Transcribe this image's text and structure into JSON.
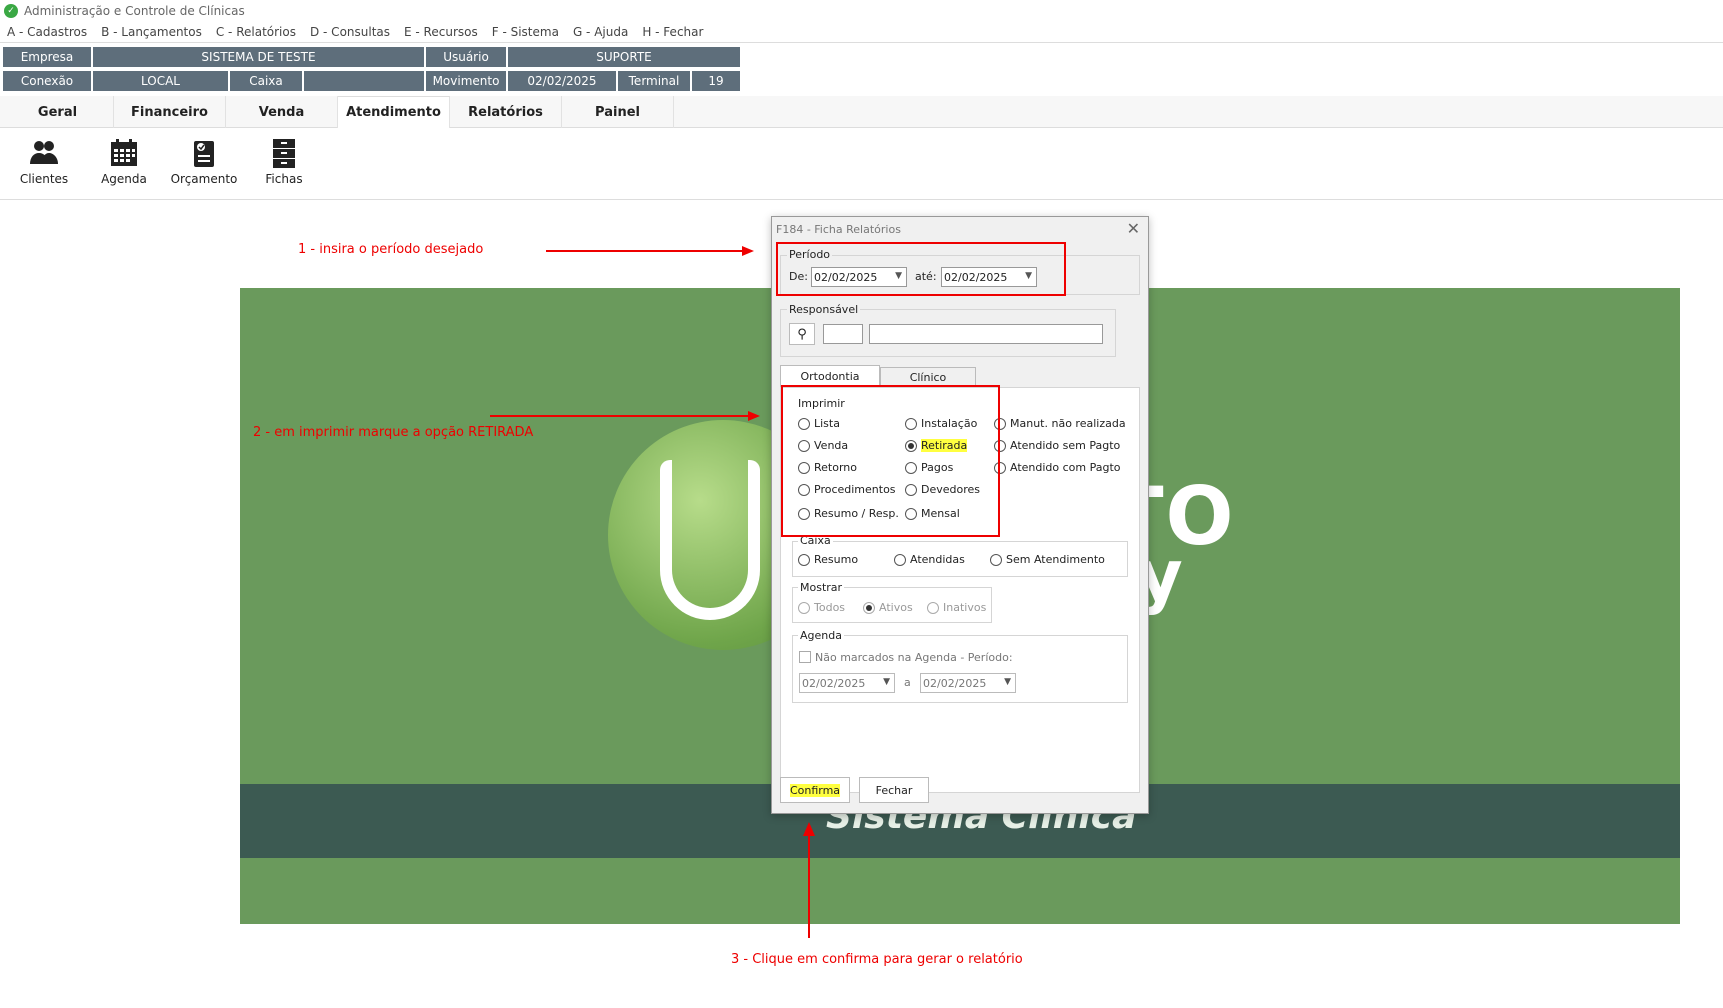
{
  "window": {
    "title": "Administração e Controle de Clínicas"
  },
  "menu": [
    "A - Cadastros",
    "B - Lançamentos",
    "C - Relatórios",
    "D - Consultas",
    "E - Recursos",
    "F - Sistema",
    "G - Ajuda",
    "H - Fechar"
  ],
  "info": {
    "empresa_label": "Empresa",
    "empresa_value": "SISTEMA DE TESTE",
    "usuario_label": "Usuário",
    "usuario_value": "SUPORTE",
    "conexao_label": "Conexão",
    "conexao_value": "LOCAL",
    "caixa_label": "Caixa",
    "caixa_value": "",
    "movimento_label": "Movimento",
    "movimento_value": "02/02/2025",
    "terminal_label": "Terminal",
    "terminal_value": "19"
  },
  "tabs": [
    "Geral",
    "Financeiro",
    "Venda",
    "Atendimento",
    "Relatórios",
    "Painel"
  ],
  "toolbar": [
    "Clientes",
    "Agenda",
    "Orçamento",
    "Fichas"
  ],
  "banner": {
    "word1": "NTO",
    "word2": "any",
    "subtitle": "Sistema Clínica"
  },
  "annotations": {
    "step1": "1 - insira o período desejado",
    "step2": "2 - em imprimir marque a opção RETIRADA",
    "step3": "3 - Clique em confirma para gerar o relatório"
  },
  "dialog": {
    "title": "F184 - Ficha Relatórios",
    "periodo_label": "Período",
    "de_label": "De:",
    "de_value": "02/02/2025",
    "ate_label": "até:",
    "ate_value": "02/02/2025",
    "responsavel_label": "Responsável",
    "tab_ortodontia": "Ortodontia",
    "tab_clinico": "Clínico",
    "imprimir_label": "Imprimir",
    "imprimir_options": [
      "Lista",
      "Venda",
      "Retorno",
      "Procedimentos",
      "Resumo / Resp.",
      "Instalação",
      "Retirada",
      "Pagos",
      "Devedores",
      "Mensal",
      "Manut. não realizada",
      "Atendido sem Pagto",
      "Atendido com Pagto"
    ],
    "imprimir_selected": "Retirada",
    "caixa_label": "Caixa",
    "caixa_options": [
      "Resumo",
      "Atendidas",
      "Sem Atendimento"
    ],
    "mostrar_label": "Mostrar",
    "mostrar_options": [
      "Todos",
      "Ativos",
      "Inativos"
    ],
    "mostrar_selected": "Ativos",
    "agenda_label": "Agenda",
    "agenda_check": "Não marcados na Agenda - Período:",
    "agenda_de": "02/02/2025",
    "agenda_a_label": "a",
    "agenda_ate": "02/02/2025",
    "confirma": "Confirma",
    "fechar": "Fechar"
  },
  "colors": {
    "infobar": "#5e6e7b",
    "banner": "#6a9a5c",
    "band": "#3c5a52",
    "annotation": "#ee0000",
    "highlight": "#ffff40"
  }
}
